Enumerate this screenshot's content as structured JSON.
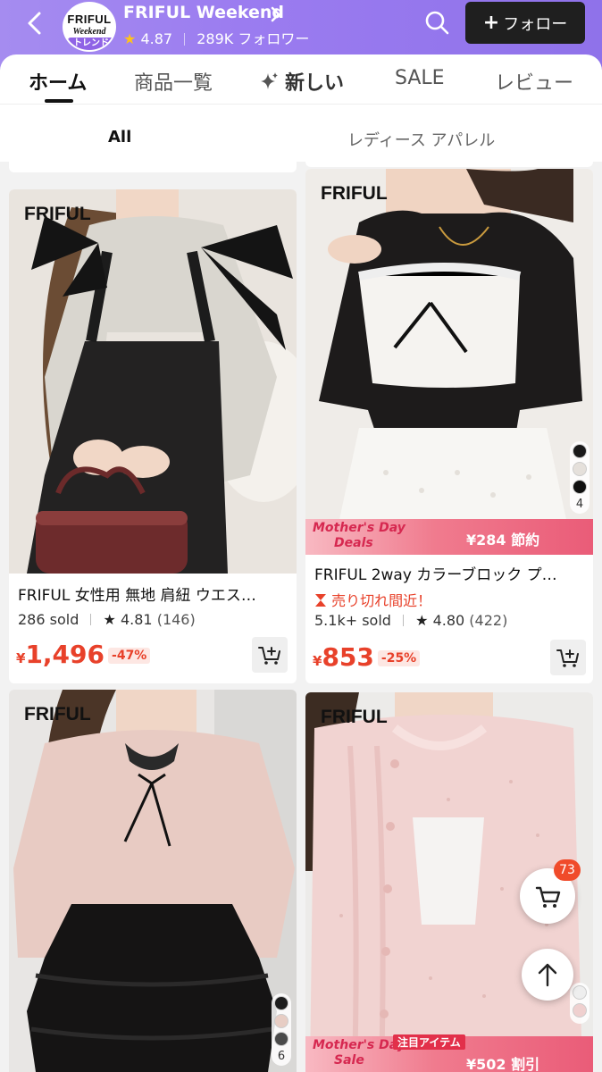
{
  "header": {
    "shop_name": "FRIFUL Weekend",
    "rating": "4.87",
    "followers": "289K フォロワー",
    "follow_label": "フォロー",
    "logo": {
      "line1": "FRIFUL",
      "line2": "Weekend",
      "badge": "トレンド"
    }
  },
  "tabs": [
    {
      "label": "ホーム",
      "active": true
    },
    {
      "label": "商品一覧"
    },
    {
      "label": "新しい"
    },
    {
      "label": "SALE"
    },
    {
      "label": "レビュー"
    }
  ],
  "sub_tabs": [
    {
      "label": "All",
      "active": true
    },
    {
      "label": "レディース アパレル"
    }
  ],
  "products": [
    {
      "brand": "FRIFUL",
      "title": "FRIFUL 女性用 無地 肩紐 ウエス…",
      "sold": "286 sold",
      "rating": "4.81",
      "reviews": "(146)",
      "currency": "¥",
      "price": "1,496",
      "discount": "-47%"
    },
    {
      "brand": "FRIFUL",
      "title": "FRIFUL 2way カラーブロック プ…",
      "stock_note": "売り切れ間近！",
      "sold": "5.1k+ sold",
      "rating": "4.80",
      "reviews": "(422)",
      "currency": "¥",
      "price": "853",
      "discount": "-25%",
      "promo": {
        "line1": "Mother's Day",
        "line2": "Deals",
        "right": "¥284 節約"
      },
      "swatch_count": "4"
    },
    {
      "brand": "FRIFUL",
      "swatch_count": "6"
    },
    {
      "brand": "FRIFUL",
      "promo": {
        "line1": "Mother's Day",
        "line2": "Sale",
        "tag": "注目アイテム",
        "right": "¥502 割引"
      }
    }
  ],
  "floating": {
    "cart_count": "73"
  },
  "colors": {
    "header": "#9b7cf0",
    "price": "#e8412a",
    "follow_bg": "#1f1f1f"
  }
}
